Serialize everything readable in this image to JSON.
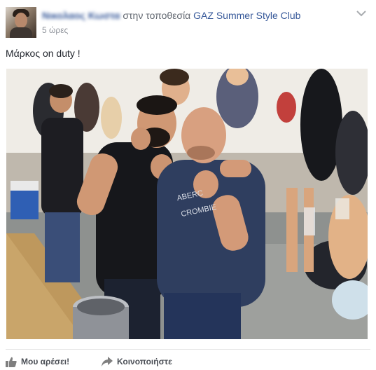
{
  "post": {
    "author": "Νικολαος Κωστα",
    "location_connector": "στην τοποθεσία",
    "location": "GAZ Summer Style Club",
    "timestamp": "5 ώρες",
    "caption": "Μάρκος on duty !",
    "photo": {
      "shirt_text_line1": "ABERC",
      "shirt_text_line2": "CROMBIE"
    }
  },
  "actions": {
    "like_label": "Μου αρέσει!",
    "share_label": "Κοινοποιήστε"
  },
  "icons": {
    "menu": "chevron-down-icon",
    "like": "thumbs-up-icon",
    "share": "share-arrow-icon"
  },
  "colors": {
    "link": "#365899",
    "meta": "#90949c",
    "action": "#4b4f56"
  }
}
